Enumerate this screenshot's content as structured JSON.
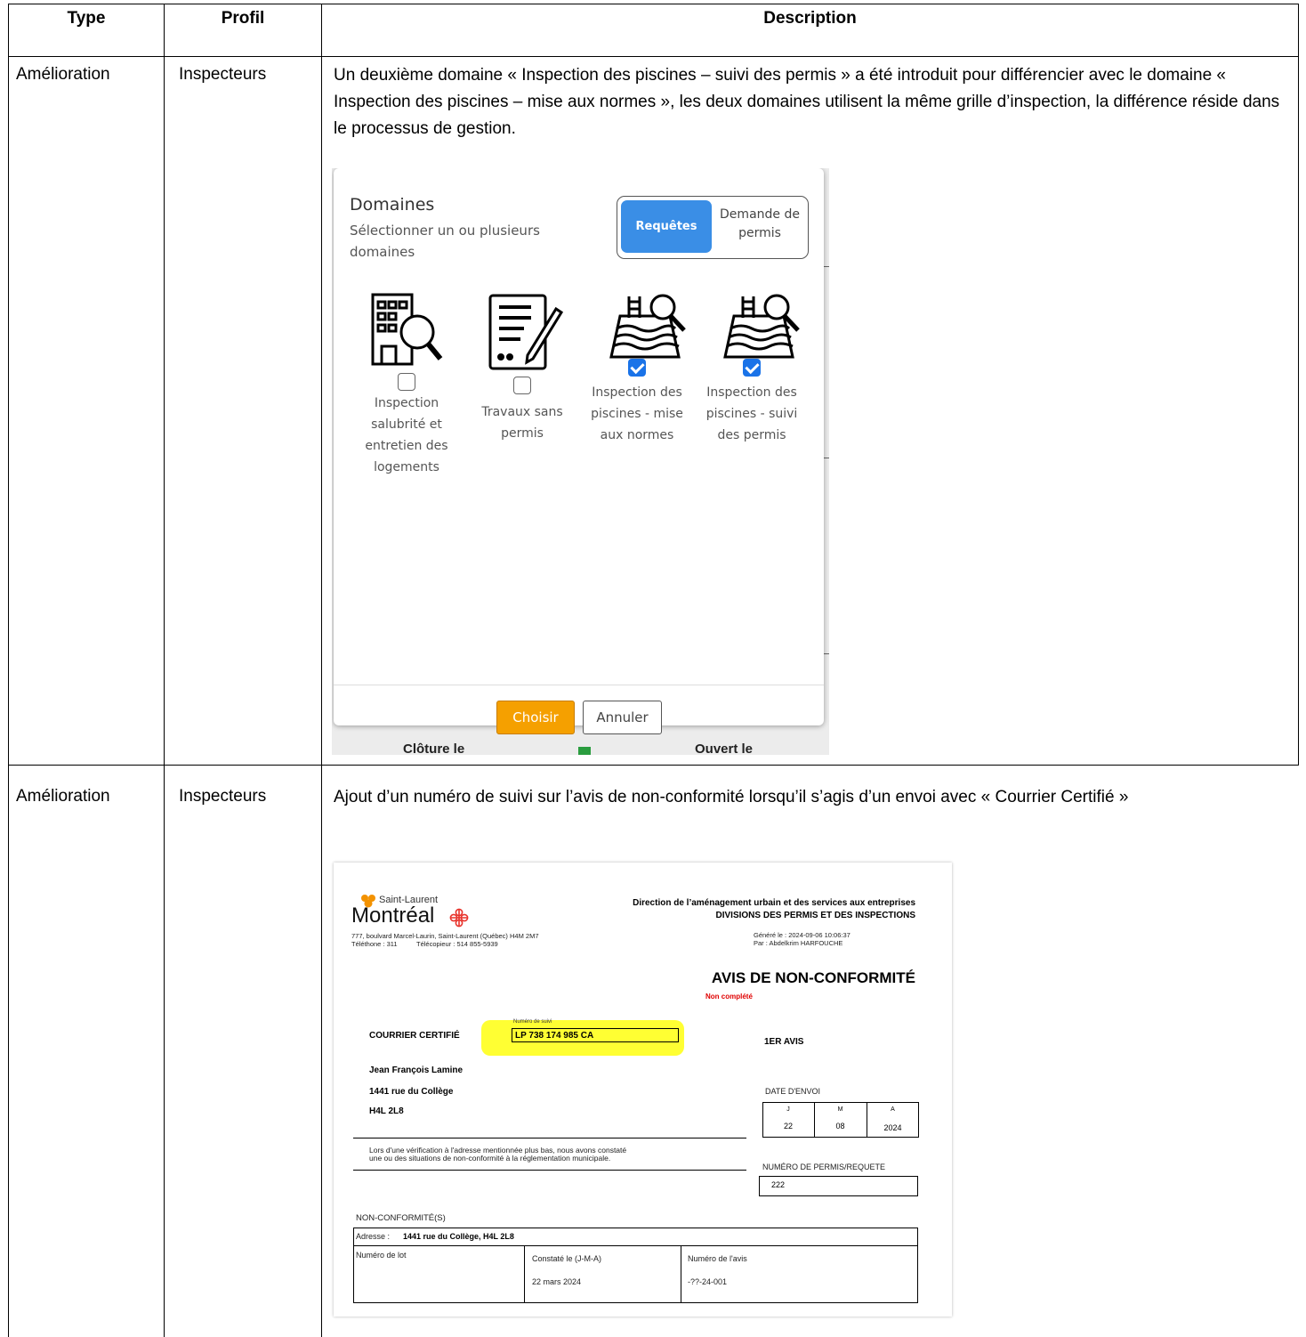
{
  "table": {
    "headers": [
      "Type",
      "Profil",
      "Description"
    ],
    "rows": [
      {
        "type": "Amélioration",
        "profil": "Inspecteurs",
        "description": "Un deuxième domaine « Inspection des piscines – suivi des permis » a été introduit pour différencier avec le domaine « Inspection des piscines – mise aux normes », les deux domaines utilisent la même grille d’inspection, la différence réside dans le processus de gestion."
      },
      {
        "type": "Amélioration",
        "profil": "Inspecteurs",
        "description": "Ajout d’un numéro de suivi sur l’avis de non-conformité lorsqu’il s’agis d’un envoi avec « Courrier Certifié »"
      }
    ]
  },
  "modal": {
    "title": "Domaines",
    "subtitle": "Sélectionner un ou plusieurs domaines",
    "toggle_active": "Requêtes",
    "toggle_inactive": "Demande de permis",
    "domains": [
      {
        "label": "Inspection salubrité et entretien des logements",
        "checked": false,
        "icon": "building-search-icon"
      },
      {
        "label": "Travaux sans permis",
        "checked": false,
        "icon": "document-pen-icon"
      },
      {
        "label": "Inspection des piscines - mise aux normes",
        "checked": true,
        "icon": "pool-search-icon"
      },
      {
        "label": "Inspection des piscines - suivi des permis",
        "checked": true,
        "icon": "pool-search-icon"
      }
    ],
    "choose_label": "Choisir",
    "cancel_label": "Annuler",
    "background_left": "Clôture le",
    "background_right": "Ouvert le"
  },
  "notice": {
    "borough": "Saint-Laurent",
    "city": "Montréal",
    "address_line": "777, boulvard Marcel-Laurin, Saint-Laurent (Québec) H4M 2M7",
    "phone_line": "Téléthone : 311",
    "fax_line": "Télécopieur : 514 855-5939",
    "direction": "Direction de l’aménagement urbain et des services aux entreprises",
    "division": "DIVISIONS DES PERMIS ET DES INSPECTIONS",
    "generated": "Généré le : 2024-09-06 10:06:37",
    "by": "Par : Abdelkrim HARFOUCHE",
    "title": "AVIS DE NON-CONFORMITÉ",
    "status": "Non complété",
    "courier": "COURRIER CERTIFIÉ",
    "tracking_label": "Numéro de suivi",
    "tracking_number": "LP 738 174 985 CA",
    "notice_rank": "1ER AVIS",
    "recipient_name": "Jean François Lamine",
    "recipient_street": "1441 rue du Collège",
    "recipient_postal": "H4L 2L8",
    "send_date_label": "DATE D'ENVOI",
    "date_heads": [
      "J",
      "M",
      "A"
    ],
    "date_values": [
      "22",
      "08",
      "2024"
    ],
    "statement_1": "Lors d'une vérification à l'adresse mentionnée plus bas, nous avons constaté",
    "statement_2": "une ou des situations de non-conformité à la réglementation municipale.",
    "permit_label": "NUMÉRO DE PERMIS/REQUETE",
    "permit_value": "222",
    "nc_heading": "NON-CONFORMITÉ(S)",
    "address_label": "Adresse :",
    "address_value": "1441 rue du Collège, H4L 2L8",
    "lot_label": "Numéro de lot",
    "observed_label": "Constaté le (J-M-A)",
    "observed_value": "22 mars 2024",
    "notice_no_label": "Numéro de l'avis",
    "notice_no_value": "-??-24-001"
  },
  "colors": {
    "toggle_active": "#3a8ee6",
    "choose_button": "#f5a000",
    "checkbox_on": "#1a73e8",
    "highlight": "#ffff33",
    "status_red": "#e00000",
    "logo_red": "#e8322b",
    "logo_orange": "#f39200"
  }
}
